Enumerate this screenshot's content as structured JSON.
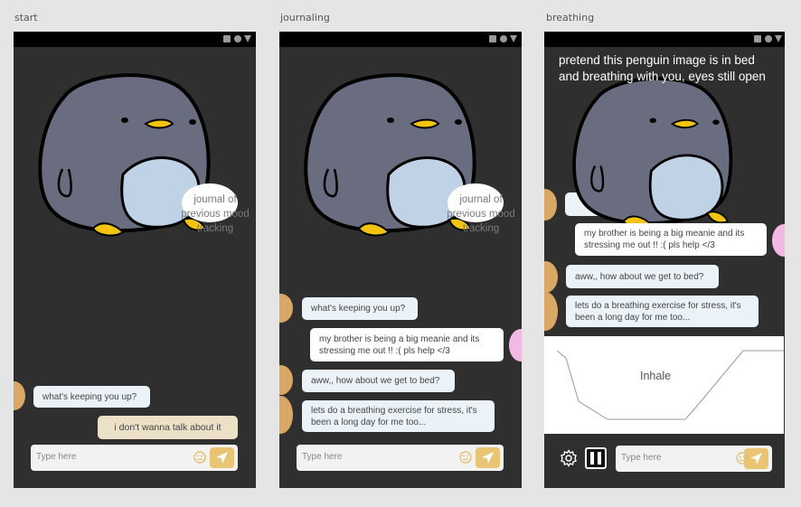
{
  "frames": {
    "start": {
      "label": "start",
      "bubble": "journal of previous mood tracking",
      "messages": {
        "bot1": "what's keeping you up?",
        "reply1": "i don't wanna talk about it"
      },
      "composer_placeholder": "Type here"
    },
    "journaling": {
      "label": "journaling",
      "bubble": "journal of previous mood tracking",
      "messages": {
        "bot1": "what's keeping you up?",
        "user1": "my brother is being a big meanie and its stressing me out !! :( pls help </3",
        "bot2": "aww,, how about we get to bed?",
        "bot3": "lets do a breathing exercise for stress, it's been a long day for me too..."
      },
      "composer_placeholder": "Type here"
    },
    "breathing": {
      "label": "breathing",
      "intro": "pretend this penguin image is in bed and breathing with you, eyes still open",
      "messages": {
        "user1": "my brother is being a big meanie and its stressing me out !! :( pls help </3",
        "bot2": "aww,, how about we get to bed?",
        "bot3": "lets do a breathing exercise for stress, it's been a long day for me too..."
      },
      "inhale_label": "Inhale",
      "composer_placeholder": "Type here"
    }
  },
  "colors": {
    "background": "#e5e5e5",
    "phone": "#2f2f2f",
    "penguin_body": "#6a6d80",
    "penguin_belly": "#c0d2e6",
    "beak": "#f3c40f",
    "send_button": "#e9c473",
    "bot_avatar": "#d9a865",
    "user_avatar": "#f3b9e4"
  }
}
